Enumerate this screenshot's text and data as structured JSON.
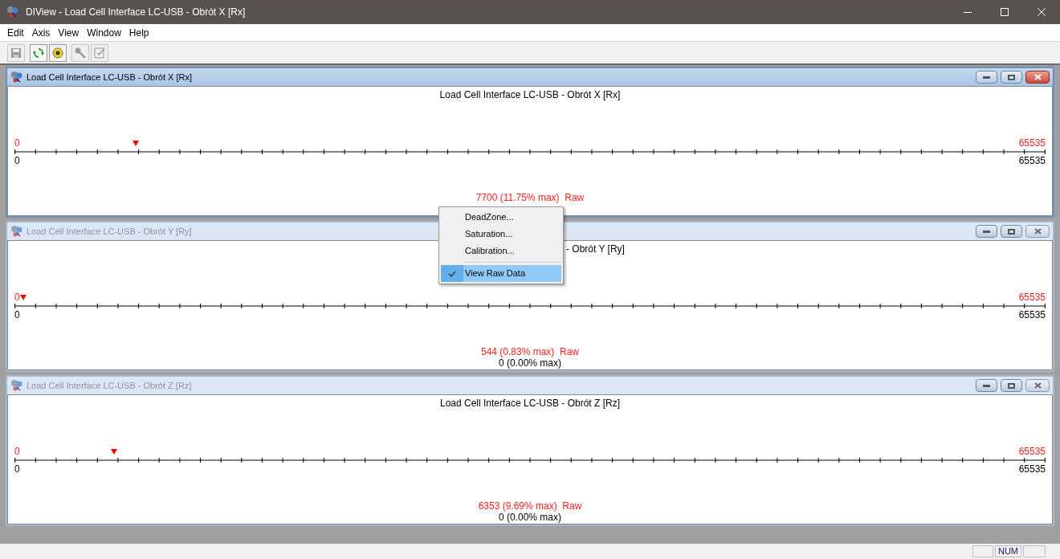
{
  "window": {
    "title": "DIView - Load Cell Interface LC-USB - Obrót X [Rx]"
  },
  "menu": [
    "Edit",
    "Axis",
    "View",
    "Window",
    "Help"
  ],
  "toolbar": [
    [
      {
        "kind": "save",
        "disabled": true
      }
    ],
    [
      {
        "kind": "refresh",
        "disabled": false
      },
      {
        "kind": "gear",
        "disabled": false
      }
    ],
    [
      {
        "kind": "wrench",
        "disabled": true
      },
      {
        "kind": "checklist",
        "disabled": true
      }
    ]
  ],
  "children": [
    {
      "title": "Load Cell Interface LC-USB - Obrót X [Rx]",
      "active": true,
      "chart_title": "Load Cell Interface LC-USB - Obrót X [Rx]",
      "title_cut": false,
      "raw_min": "0",
      "raw_max": "65535",
      "min": "0",
      "max": "65535",
      "level": 0.1175,
      "readings": [
        {
          "text": "7700 (11.75% max)  Raw",
          "kind": "raw"
        }
      ]
    },
    {
      "title": "Load Cell Interface LC-USB - Obrót Y [Ry]",
      "active": false,
      "chart_title": "- Obrót Y [Ry]",
      "title_cut": true,
      "raw_min": "0",
      "raw_max": "65535",
      "min": "0",
      "max": "65535",
      "level": 0.0083,
      "readings": [
        {
          "text": "544 (0.83% max)  Raw",
          "kind": "raw"
        },
        {
          "text": "0 (0.00% max)",
          "kind": "calibrated"
        }
      ]
    },
    {
      "title": "Load Cell Interface LC-USB - Obrót Z [Rz]",
      "active": false,
      "chart_title": "Load Cell Interface LC-USB - Obrót Z [Rz]",
      "title_cut": false,
      "raw_min": "0",
      "raw_max": "65535",
      "min": "0",
      "max": "65535",
      "level": 0.0969,
      "readings": [
        {
          "text": "6353 (9.69% max)  Raw",
          "kind": "raw"
        },
        {
          "text": "0 (0.00% max)",
          "kind": "calibrated"
        }
      ]
    }
  ],
  "context_menu": [
    {
      "kind": "item",
      "label": "DeadZone...",
      "checked": false,
      "selected": false
    },
    {
      "kind": "item",
      "label": "Saturation...",
      "checked": false,
      "selected": false
    },
    {
      "kind": "item",
      "label": "Calibration...",
      "checked": false,
      "selected": false
    },
    {
      "kind": "separator"
    },
    {
      "kind": "item",
      "label": "View Raw Data",
      "checked": true,
      "selected": true
    }
  ],
  "status_bar": {
    "panes": [
      "NUM"
    ]
  }
}
